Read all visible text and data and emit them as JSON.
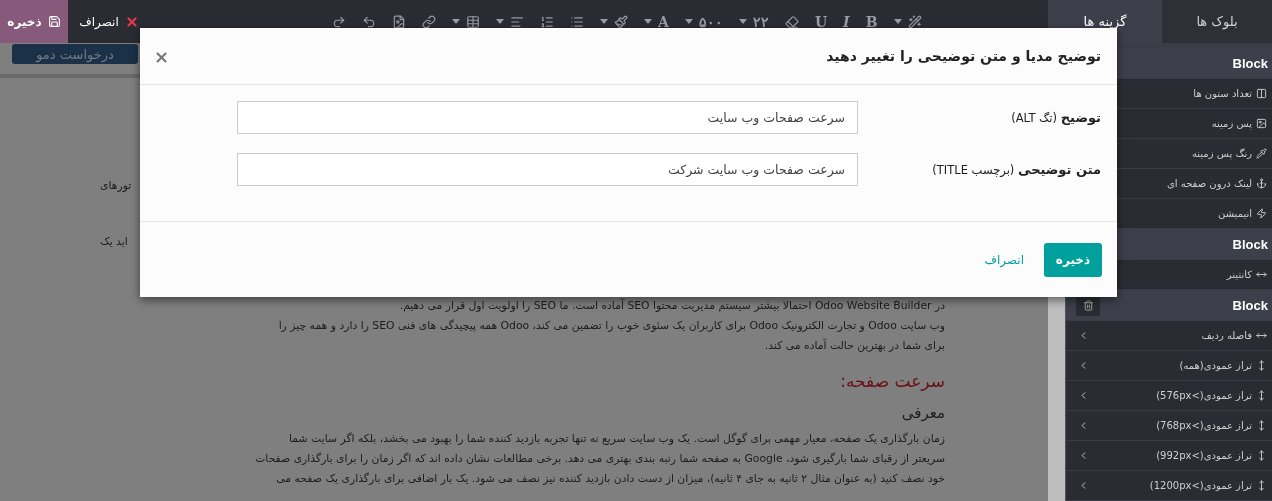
{
  "topbar": {
    "save_button": "ذخیره",
    "cancel_button": "انصراف"
  },
  "toolbar": {
    "letter_a": "A",
    "font_weight": "۵۰۰",
    "font_size": "۲۲",
    "underline": "U",
    "italic": "I",
    "bold": "B"
  },
  "tabs": [
    {
      "label": "بلوک ها",
      "selected": false
    },
    {
      "label": "گزینه ها",
      "selected": true
    }
  ],
  "page": {
    "demo_button": "درخواست دمو",
    "lines": [
      {
        "kind": "fragment",
        "text": "تورهای"
      },
      {
        "kind": "fragment",
        "text": "اید یک"
      },
      {
        "kind": "gap_line",
        "text": "در Odoo Website Builder احتمالا بیشتر سیستم مدیریت محتوا SEO آماده است. ما SEO را اولویت اول قرار می دهیم."
      },
      {
        "kind": "line",
        "text": "وب سایت Odoo و تجارت الکترونیک Odoo برای کاربران یک سئوی خوب را تضمین می کند، Odoo همه پیچیدگی های فنی SEO را دارد و همه چیز را"
      },
      {
        "kind": "line",
        "text": "برای شما در بهترین حالت آماده می کند."
      },
      {
        "kind": "heading",
        "text": "سرعت صفحه:"
      },
      {
        "kind": "subheading",
        "text": "معرفی"
      },
      {
        "kind": "line",
        "text": "زمان بارگذاری یک صفحه، معیار مهمی برای گوگل است. یک وب سایت سریع نه تنها تجربه بازدید کننده شما را بهبود می بخشد، بلکه اگر سایت شما"
      },
      {
        "kind": "line",
        "text": "سریعتر از رقبای شما بارگیری شود، Google به صفحه شما رتبه بندی بهتری می دهد. برخی مطالعات نشان داده اند که اگر زمان را برای بارگذاری صفحات"
      },
      {
        "kind": "line",
        "text": "خود نصف کنید (به عنوان مثال ۲ ثانیه به جای ۴ ثانیه)، میزان از دست دادن بازدید کننده نیز نصف می شود. یک بار اضافی برای بارگذاری یک صفحه می"
      }
    ]
  },
  "sidebar": [
    {
      "title": "Block",
      "items": [
        {
          "label": "تعداد ستون ها",
          "kind": "option"
        },
        {
          "label": "پس زمینه",
          "kind": "option"
        },
        {
          "label": "رنگ پس زمینه",
          "kind": "option"
        },
        {
          "label": "لینک درون صفحه ای",
          "kind": "option"
        },
        {
          "label": "انیمیشن",
          "kind": "option"
        }
      ]
    },
    {
      "title": "Block",
      "items": [
        {
          "label": "کانتینر",
          "kind": "option"
        }
      ]
    },
    {
      "title": "Block",
      "items": [
        {
          "label": "فاصله ردیف",
          "kind": "expandable"
        },
        {
          "label": "تراز عمودی(همه)",
          "kind": "expandable"
        },
        {
          "label": "تراز عمودی(>576px)",
          "kind": "expandable"
        },
        {
          "label": "تراز عمودی(>768px)",
          "kind": "expandable"
        },
        {
          "label": "تراز عمودی(>992px)",
          "kind": "expandable"
        },
        {
          "label": "تراز عمودی(>1200px)",
          "kind": "expandable"
        }
      ]
    }
  ],
  "dialog": {
    "title": "توضیح مدیا و متن توضیحی را تغییر دهید",
    "close": "×",
    "fields": [
      {
        "label": "**توضیح** (تگ ALT)",
        "value": "سرعت صفحات وب سایت"
      },
      {
        "label": "**متن توضیحی** (برچسب TITLE)",
        "value": "سرعت صفحات وب سایت شرکت"
      }
    ],
    "save_button": "ذخیره",
    "cancel_button": "انصراف"
  }
}
